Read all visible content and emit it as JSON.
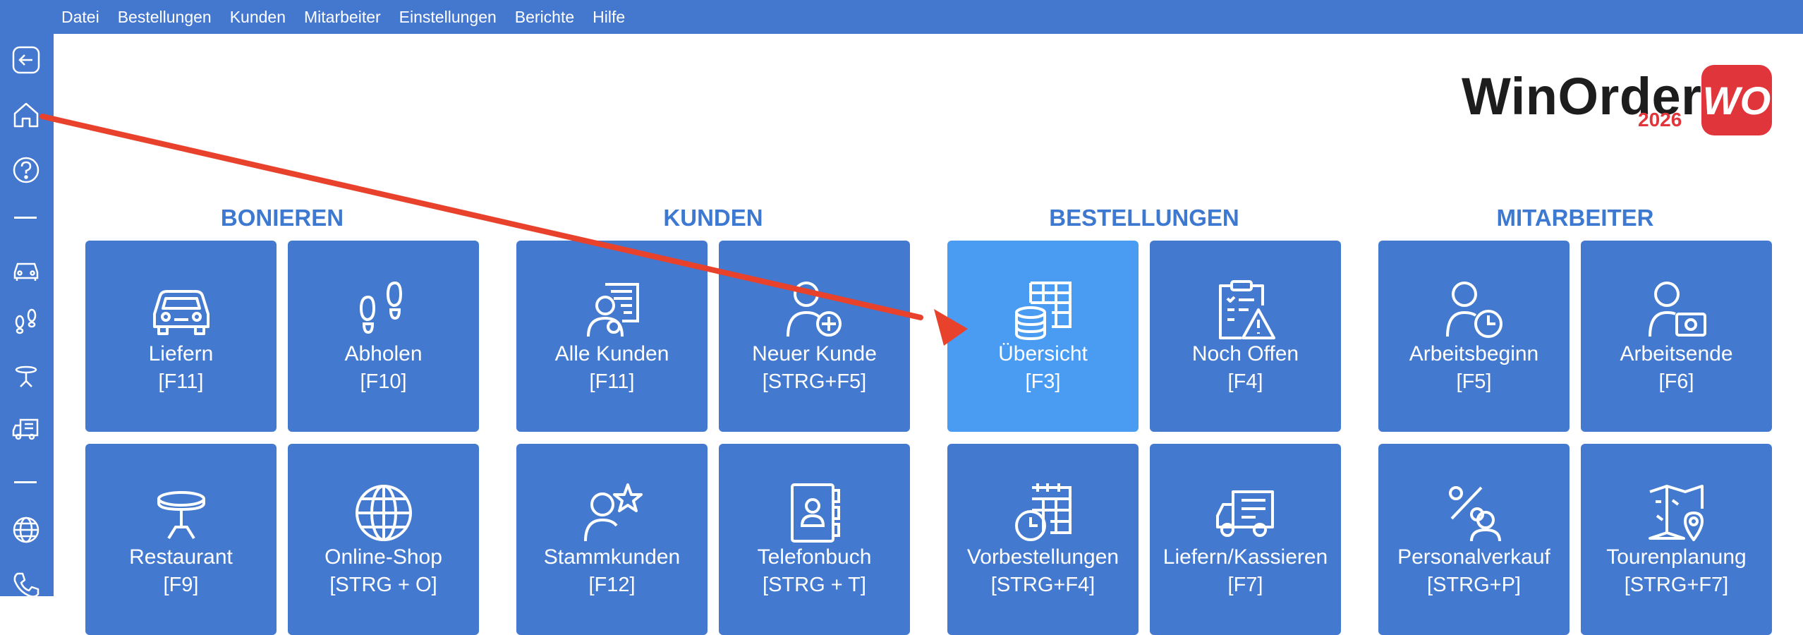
{
  "menu": [
    "Datei",
    "Bestellungen",
    "Kunden",
    "Mitarbeiter",
    "Einstellungen",
    "Berichte",
    "Hilfe"
  ],
  "logo": {
    "name": "WinOrder",
    "year": "2026",
    "badge": "WO"
  },
  "sections": {
    "bonieren": "BONIEREN",
    "kunden": "KUNDEN",
    "bestellungen": "BESTELLUNGEN",
    "mitarbeiter": "MITARBEITER"
  },
  "tiles": {
    "liefern": {
      "label": "Liefern",
      "key": "[F11]"
    },
    "abholen": {
      "label": "Abholen",
      "key": "[F10]"
    },
    "alle_kunden": {
      "label": "Alle Kunden",
      "key": "[F11]"
    },
    "neuer_kunde": {
      "label": "Neuer Kunde",
      "key": "[STRG+F5]"
    },
    "uebersicht": {
      "label": "Übersicht",
      "key": "[F3]"
    },
    "noch_offen": {
      "label": "Noch Offen",
      "key": "[F4]"
    },
    "arbeitsbeginn": {
      "label": "Arbeitsbeginn",
      "key": "[F5]"
    },
    "arbeitsende": {
      "label": "Arbeitsende",
      "key": "[F6]"
    },
    "restaurant": {
      "label": "Restaurant",
      "key": "[F9]"
    },
    "online_shop": {
      "label": "Online-Shop",
      "key": "[STRG + O]"
    },
    "stammkunden": {
      "label": "Stammkunden",
      "key": "[F12]"
    },
    "telefonbuch": {
      "label": "Telefonbuch",
      "key": "[STRG + T]"
    },
    "vorbestellungen": {
      "label": "Vorbestellungen",
      "key": "[STRG+F4]"
    },
    "liefern_kassieren": {
      "label": "Liefern/Kassieren",
      "key": "[F7]"
    },
    "personalverkauf": {
      "label": "Personalverkauf",
      "key": "[STRG+P]"
    },
    "tourenplanung": {
      "label": "Tourenplanung",
      "key": "[STRG+F7]"
    }
  },
  "colors": {
    "bar": "#4478cf",
    "tile": "#4379cf",
    "tile_active": "#4a9bf2",
    "section_title": "#3d78d1",
    "annotation_arrow": "#e8412c",
    "logo_red": "#e0353a"
  }
}
